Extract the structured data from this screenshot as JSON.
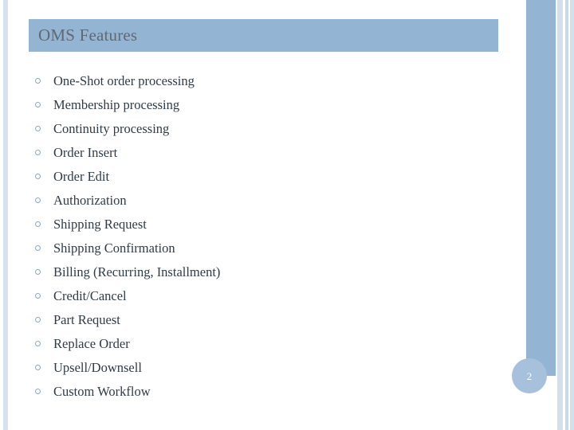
{
  "slide": {
    "title": "OMS Features",
    "page_number": "2"
  },
  "theme": {
    "accent_blue": "#94b4d4",
    "stripe_light": "#d3e0ec",
    "left_stripe": "#d6e2ee",
    "badge_fill": "#a7c1dc",
    "badge_text": "#ffffff",
    "title_text": "#5f6a72",
    "body_text": "#2f3b47",
    "bullet_outline": "#8fa8bd"
  },
  "bullets": [
    {
      "label": "One-Shot order processing"
    },
    {
      "label": "Membership processing"
    },
    {
      "label": "Continuity processing"
    },
    {
      "label": "Order Insert"
    },
    {
      "label": "Order Edit"
    },
    {
      "label": "Authorization"
    },
    {
      "label": "Shipping Request"
    },
    {
      "label": "Shipping Confirmation"
    },
    {
      "label": "Billing (Recurring, Installment)"
    },
    {
      "label": "Credit/Cancel"
    },
    {
      "label": "Part Request"
    },
    {
      "label": "Replace Order"
    },
    {
      "label": "Upsell/Downsell"
    },
    {
      "label": "Custom Workflow"
    }
  ]
}
